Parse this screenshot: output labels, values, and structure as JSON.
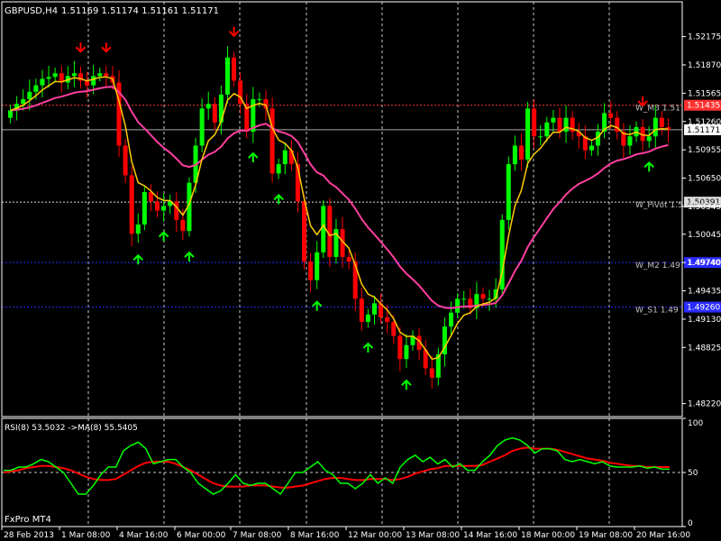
{
  "header": {
    "symbol": "GBPUSD,H4",
    "quote": "1.51169 1.51174 1.51161 1.51171"
  },
  "footer": {
    "broker": "FxPro MT4"
  },
  "colors": {
    "background": "#000000",
    "grid": "#c8c8c8",
    "bull": "#00ff00",
    "bear": "#ff0000",
    "ma_fast": "#ffcc00",
    "ma_slow": "#ff3fa0",
    "rsi": "#00ff00",
    "rsi_ma": "#ff0000",
    "label_text": "#c0c0c0",
    "badge_red": "#ff3030",
    "badge_blue": "#2b2bff",
    "badge_price": "#ffffff"
  },
  "levels": [
    {
      "label": "W_M3 1.51",
      "price": 1.51435,
      "color": "#ff3030",
      "badge": "1.51435"
    },
    {
      "label": "W_Pivot 1.5",
      "price": 1.50391,
      "color": "#dddddd",
      "badge": "1.50391"
    },
    {
      "label": "W_M2 1.49",
      "price": 1.4974,
      "color": "#2b2bff",
      "badge": "1.49740"
    },
    {
      "label": "W_S1 1.49",
      "price": 1.4926,
      "color": "#2b2bff",
      "badge": "1.49260"
    }
  ],
  "chart_data": [
    {
      "type": "candlestick",
      "title": "GBPUSD,H4",
      "current_price": 1.51171,
      "y_ticks": [
        1.52175,
        1.5187,
        1.51565,
        1.5126,
        1.50955,
        1.5065,
        1.50345,
        1.50045,
        1.4974,
        1.49435,
        1.4913,
        1.48825,
        1.4822
      ],
      "x_ticks": [
        "28 Feb 2013",
        "1 Mar 08:00",
        "4 Mar 16:00",
        "6 Mar 00:00",
        "7 Mar 08:00",
        "8 Mar 16:00",
        "12 Mar 00:00",
        "13 Mar 08:00",
        "14 Mar 16:00",
        "18 Mar 00:00",
        "19 Mar 08:00",
        "20 Mar 16:00"
      ],
      "ylim": [
        1.4808,
        1.5255
      ],
      "grid": true,
      "close": [
        1.5138,
        1.5145,
        1.515,
        1.5158,
        1.5165,
        1.5172,
        1.5174,
        1.5178,
        1.5168,
        1.5175,
        1.5178,
        1.517,
        1.5165,
        1.5175,
        1.5178,
        1.5175,
        1.5168,
        1.51,
        1.5068,
        1.5005,
        1.5015,
        1.505,
        1.504,
        1.503,
        1.5035,
        1.504,
        1.502,
        1.5008,
        1.506,
        1.51,
        1.514,
        1.5145,
        1.5125,
        1.5155,
        1.5195,
        1.517,
        1.5145,
        1.5115,
        1.515,
        1.515,
        1.514,
        1.507,
        1.508,
        1.5095,
        1.508,
        1.504,
        1.4975,
        1.4955,
        1.4985,
        1.5035,
        1.498,
        1.501,
        1.498,
        1.4975,
        1.4935,
        1.491,
        1.4918,
        1.493,
        1.4915,
        1.491,
        1.4895,
        1.487,
        1.4885,
        1.4895,
        1.488,
        1.486,
        1.485,
        1.4875,
        1.4905,
        1.492,
        1.4935,
        1.4935,
        1.4925,
        1.494,
        1.4935,
        1.4935,
        1.4945,
        1.502,
        1.508,
        1.51,
        1.5085,
        1.514,
        1.511,
        1.511,
        1.5125,
        1.513,
        1.5115,
        1.513,
        1.5115,
        1.511,
        1.5095,
        1.51,
        1.5115,
        1.5135,
        1.513,
        1.5115,
        1.51,
        1.511,
        1.512,
        1.5105,
        1.511,
        1.513,
        1.512,
        1.5117
      ]
    },
    {
      "type": "line",
      "title": "RSI(8) 53.5032  ->MA(8) 55.5405",
      "y_ticks": [
        100,
        50,
        0
      ],
      "ylim": [
        0,
        100
      ],
      "grid": true,
      "series": [
        {
          "name": "RSI(8) 53.5032",
          "values": [
            52,
            52,
            55,
            55,
            58,
            62,
            60,
            55,
            50,
            40,
            30,
            30,
            38,
            48,
            55,
            55,
            70,
            75,
            78,
            72,
            58,
            60,
            62,
            62,
            55,
            50,
            40,
            35,
            30,
            33,
            40,
            48,
            40,
            38,
            40,
            40,
            35,
            30,
            40,
            50,
            50,
            55,
            60,
            52,
            48,
            40,
            40,
            35,
            40,
            48,
            40,
            45,
            40,
            55,
            62,
            66,
            60,
            64,
            58,
            62,
            55,
            58,
            52,
            52,
            60,
            66,
            75,
            80,
            82,
            80,
            75,
            68,
            72,
            72,
            70,
            62,
            60,
            62,
            60,
            58,
            60,
            56,
            55,
            55,
            55,
            56,
            54,
            55,
            53,
            53
          ]
        },
        {
          "name": "MA(8) 55.5405",
          "values": [
            50,
            51,
            52,
            54,
            55,
            56,
            56,
            55,
            54,
            52,
            49,
            46,
            44,
            43,
            43,
            44,
            48,
            52,
            56,
            59,
            60,
            60,
            60,
            58,
            55,
            52,
            48,
            44,
            40,
            38,
            37,
            37,
            37,
            38,
            38,
            38,
            37,
            36,
            36,
            37,
            38,
            40,
            42,
            44,
            45,
            45,
            44,
            43,
            43,
            44,
            44,
            44,
            43,
            44,
            46,
            49,
            51,
            53,
            54,
            56,
            56,
            56,
            56,
            56,
            57,
            60,
            63,
            66,
            70,
            72,
            73,
            72,
            72,
            72,
            71,
            69,
            67,
            65,
            63,
            62,
            61,
            59,
            58,
            57,
            56,
            56,
            55,
            55,
            55,
            55
          ]
        }
      ]
    }
  ]
}
